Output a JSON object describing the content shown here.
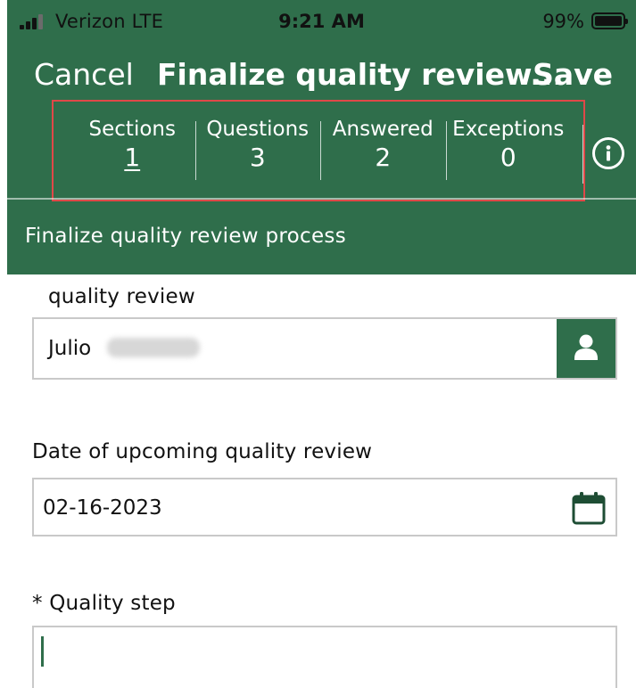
{
  "status_bar": {
    "carrier": "Verizon  LTE",
    "time": "9:21 AM",
    "battery": "99%"
  },
  "nav": {
    "cancel": "Cancel",
    "title": "Finalize quality review...",
    "save": "Save"
  },
  "stats": [
    {
      "label": "Sections",
      "value": "1"
    },
    {
      "label": "Questions",
      "value": "3"
    },
    {
      "label": "Answered",
      "value": "2"
    },
    {
      "label": "Exceptions",
      "value": "0"
    }
  ],
  "section": {
    "title": "Finalize quality review process"
  },
  "form": {
    "reviewer": {
      "label": "quality review",
      "value": "Julio"
    },
    "date": {
      "label": "Date of upcoming quality review",
      "value": "02-16-2023"
    },
    "step": {
      "label": "* Quality step",
      "value": ""
    }
  },
  "colors": {
    "brand_green": "#2f6e4b",
    "highlight_red": "#e04848"
  },
  "icons": [
    "signal-icon",
    "battery-icon",
    "info-icon",
    "person-icon",
    "calendar-icon"
  ]
}
